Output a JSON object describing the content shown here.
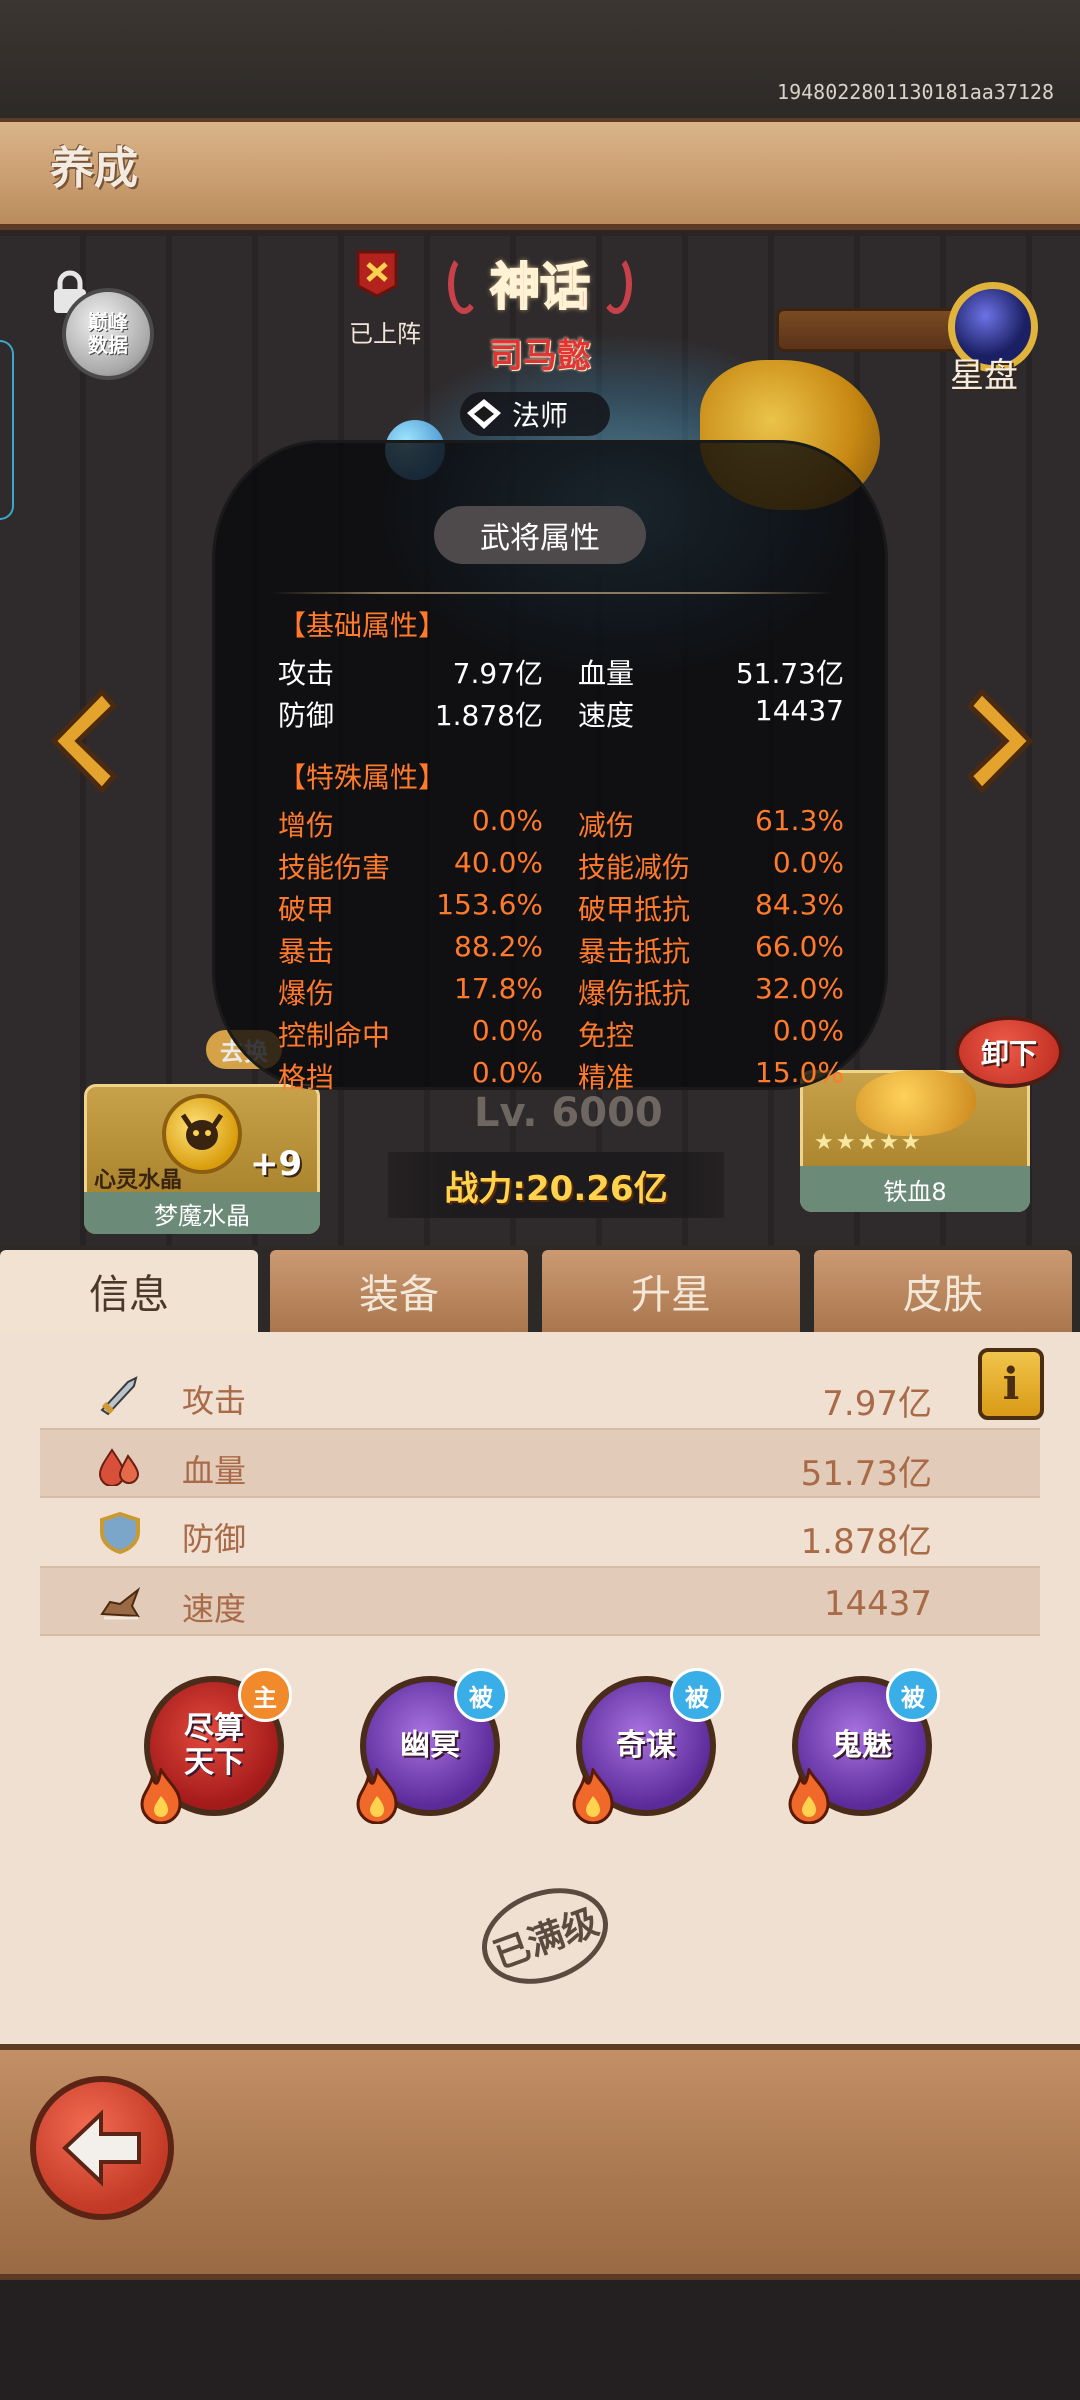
{
  "status": {
    "device_id": "1948022801130181aa37128"
  },
  "header": {
    "title": "养成"
  },
  "hero": {
    "deploy_label": "已上阵",
    "rank": "神话",
    "name": "司马懿",
    "class": "法师",
    "peak_data_label": "巅峰\n数据",
    "star_disk_label": "星盘",
    "level": "Lv. 6000",
    "power": "战力:20.26亿"
  },
  "attr_panel": {
    "title": "武将属性",
    "basic_heading": "【基础属性】",
    "basic": [
      {
        "l_name": "攻击",
        "l_val": "7.97亿",
        "r_name": "血量",
        "r_val": "51.73亿"
      },
      {
        "l_name": "防御",
        "l_val": "1.878亿",
        "r_name": "速度",
        "r_val": "14437"
      }
    ],
    "special_heading": "【特殊属性】",
    "special": [
      {
        "l_name": "增伤",
        "l_val": "0.0%",
        "r_name": "减伤",
        "r_val": "61.3%"
      },
      {
        "l_name": "技能伤害",
        "l_val": "40.0%",
        "r_name": "技能减伤",
        "r_val": "0.0%"
      },
      {
        "l_name": "破甲",
        "l_val": "153.6%",
        "r_name": "破甲抵抗",
        "r_val": "84.3%"
      },
      {
        "l_name": "暴击",
        "l_val": "88.2%",
        "r_name": "暴击抵抗",
        "r_val": "66.0%"
      },
      {
        "l_name": "爆伤",
        "l_val": "17.8%",
        "r_name": "爆伤抵抗",
        "r_val": "32.0%"
      },
      {
        "l_name": "控制命中",
        "l_val": "0.0%",
        "r_name": "免控",
        "r_val": "0.0%"
      },
      {
        "l_name": "格挡",
        "l_val": "0.0%",
        "r_name": "精准",
        "r_val": "15.0%"
      }
    ]
  },
  "left_equip": {
    "swap_label": "去换",
    "slot_label": "心灵水晶",
    "plus": "+9",
    "name": "梦魔水晶"
  },
  "right_equip": {
    "unload_label": "卸下",
    "stars": "★★★★★",
    "name": "铁血8"
  },
  "tabs": [
    {
      "label": "信息",
      "active": true
    },
    {
      "label": "装备",
      "active": false
    },
    {
      "label": "升星",
      "active": false
    },
    {
      "label": "皮肤",
      "active": false
    }
  ],
  "info": {
    "button_label": "i",
    "stats": [
      {
        "icon": "sword-icon",
        "name": "攻击",
        "value": "7.97亿"
      },
      {
        "icon": "blood-drop-icon",
        "name": "血量",
        "value": "51.73亿"
      },
      {
        "icon": "shield-icon",
        "name": "防御",
        "value": "1.878亿"
      },
      {
        "icon": "boot-icon",
        "name": "速度",
        "value": "14437"
      }
    ]
  },
  "skills": [
    {
      "name": "尽算天下",
      "tag": "主",
      "type": "main"
    },
    {
      "name": "幽冥",
      "tag": "被",
      "type": "passive"
    },
    {
      "name": "奇谋",
      "tag": "被",
      "type": "passive"
    },
    {
      "name": "鬼魅",
      "tag": "被",
      "type": "passive"
    }
  ],
  "maxed_label": "已满级",
  "colors": {
    "accent_orange": "#ff7a2a",
    "power_gold": "#ffd34e",
    "rank_red": "#e8233a",
    "panel_bg": "#efe0d1"
  }
}
